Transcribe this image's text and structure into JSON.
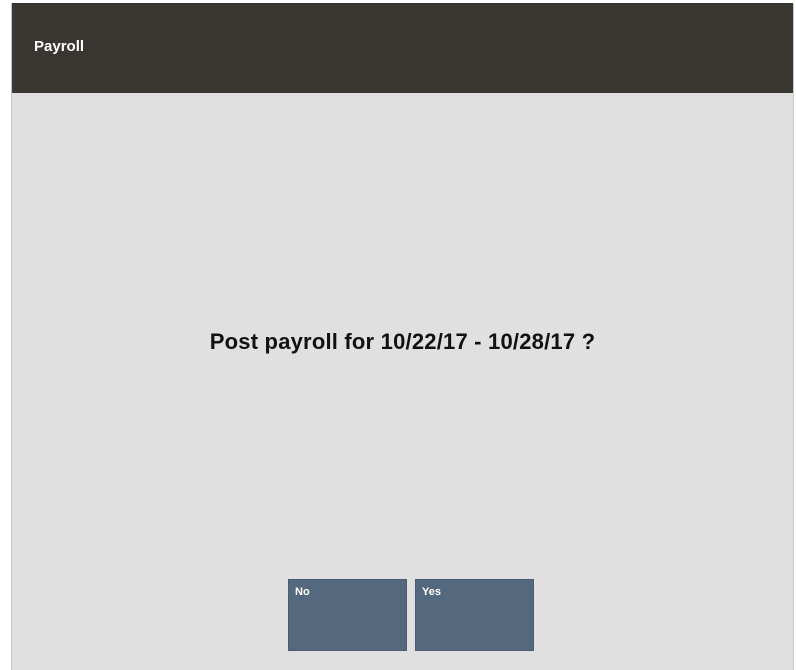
{
  "window": {
    "title": "Payroll"
  },
  "dialog": {
    "message": "Post payroll for 10/22/17 - 10/28/17 ?"
  },
  "buttons": {
    "no_label": "No",
    "yes_label": "Yes"
  },
  "colors": {
    "titlebar": "#3a3632",
    "background": "#e0e0e0",
    "button": "#55697e",
    "button_text": "#ffffff"
  }
}
